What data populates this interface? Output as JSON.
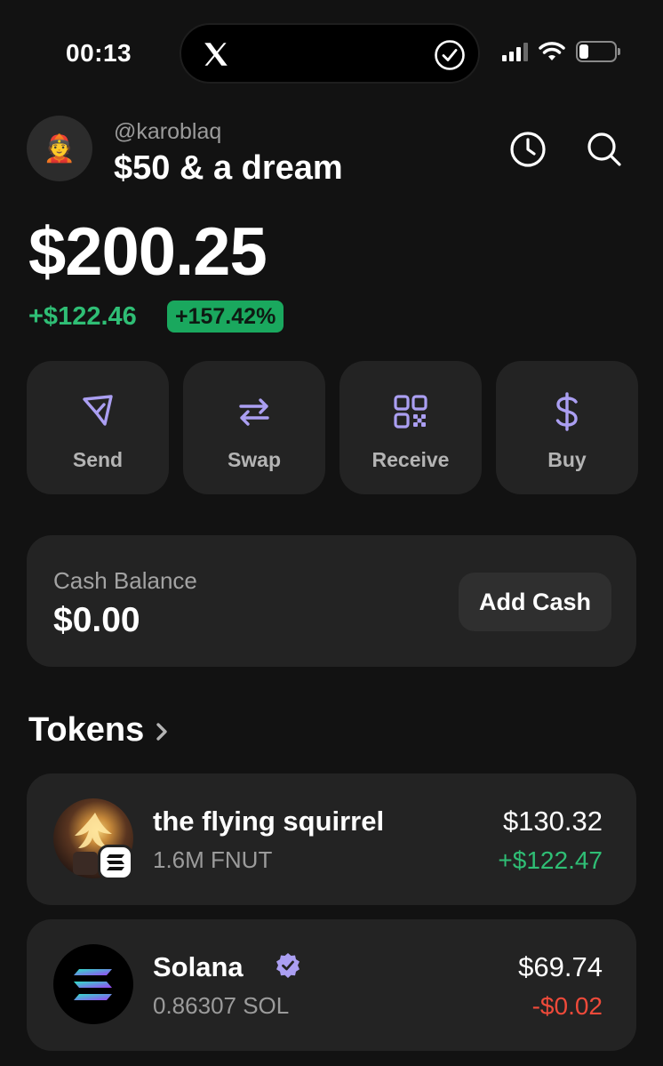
{
  "status_bar": {
    "time": "00:13"
  },
  "header": {
    "username": "@karoblaq",
    "wallet_name": "$50 & a dream",
    "avatar_emoji": "👲"
  },
  "balance": {
    "total": "$200.25",
    "change_amount": "+$122.46",
    "change_percent": "+157.42%"
  },
  "actions": [
    {
      "label": "Send",
      "icon": "send-icon"
    },
    {
      "label": "Swap",
      "icon": "swap-icon"
    },
    {
      "label": "Receive",
      "icon": "qr-code-icon"
    },
    {
      "label": "Buy",
      "icon": "dollar-icon"
    }
  ],
  "cash": {
    "label": "Cash Balance",
    "value": "$0.00",
    "button": "Add Cash"
  },
  "tokens": {
    "title": "Tokens",
    "items": [
      {
        "name": "the flying squirrel",
        "quantity": "1.6M FNUT",
        "value": "$130.32",
        "change": "+$122.47",
        "verified": false
      },
      {
        "name": "Solana",
        "quantity": "0.86307 SOL",
        "value": "$69.74",
        "change": "-$0.02",
        "verified": true
      }
    ]
  },
  "colors": {
    "accent": "#ab9ff2",
    "positive": "#2fbe75",
    "negative": "#ef4a3a",
    "card": "#232323",
    "background": "#121212"
  }
}
